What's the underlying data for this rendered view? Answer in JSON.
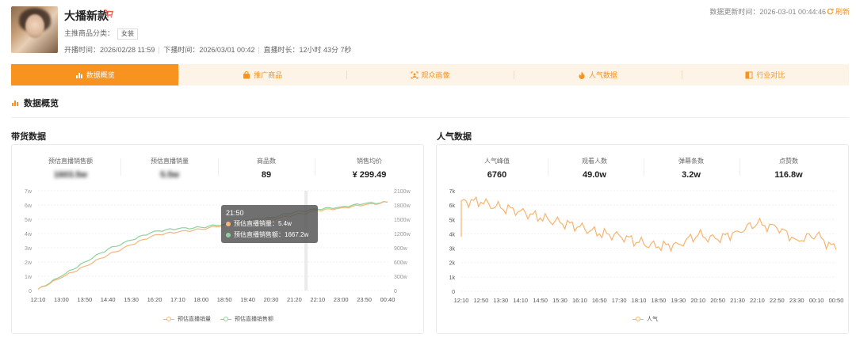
{
  "header": {
    "title": "大播新款",
    "category_label": "主推商品分类：",
    "category_tag": "女装",
    "start_time": "开播时间：2026/02/28 11:59",
    "end_time": "下播时间：2026/03/01 00:42",
    "duration": "直播时长：12小时 43分 7秒",
    "update_time": "数据更新时间：2026-03-01 00:44:46",
    "refresh_label": "刷新"
  },
  "tabs": [
    {
      "label": "数据概览",
      "icon": "bar-chart-icon",
      "active": true
    },
    {
      "label": "推广商品",
      "icon": "shopping-bag-icon",
      "active": false
    },
    {
      "label": "观众画像",
      "icon": "audience-icon",
      "active": false
    },
    {
      "label": "人气数据",
      "icon": "flame-icon",
      "active": false
    },
    {
      "label": "行业对比",
      "icon": "compare-icon",
      "active": false
    }
  ],
  "section_title": "数据概览",
  "sales": {
    "title": "带货数据",
    "kpis": [
      {
        "label": "预估直播销售额",
        "value": "1603.5w",
        "blurred": true
      },
      {
        "label": "预估直播销量",
        "value": "5.5w",
        "blurred": true
      },
      {
        "label": "商品数",
        "value": "89",
        "blurred": false
      },
      {
        "label": "销售均价",
        "value": "¥ 299.49",
        "blurred": false
      }
    ]
  },
  "popularity": {
    "title": "人气数据",
    "kpis": [
      {
        "label": "人气峰值",
        "value": "6760"
      },
      {
        "label": "观看人数",
        "value": "49.0w"
      },
      {
        "label": "弹幕条数",
        "value": "3.2w"
      },
      {
        "label": "点赞数",
        "value": "116.8w"
      }
    ]
  },
  "tooltip": {
    "time": "21:50",
    "rows": [
      {
        "text": "预估直播销量：5.4w",
        "color": "#f5b67b"
      },
      {
        "text": "预估直播销售额：1667.2w",
        "color": "#8fd19e"
      }
    ]
  },
  "colors": {
    "accent": "#f7931e",
    "volume": "#f5b67b",
    "revenue": "#8fd19e",
    "popularity": "#f6b46e"
  },
  "chart_data": [
    {
      "type": "line",
      "title": "",
      "x": [
        "12:10",
        "13:00",
        "13:50",
        "14:40",
        "15:30",
        "16:20",
        "17:10",
        "18:00",
        "18:50",
        "19:40",
        "20:30",
        "21:20",
        "22:10",
        "23:00",
        "23:50",
        "00:40"
      ],
      "y_left_ticks": [
        "0",
        "1w",
        "2w",
        "3w",
        "4w",
        "5w",
        "6w",
        "7w"
      ],
      "y_right_ticks": [
        "0",
        "300w",
        "600w",
        "900w",
        "1200w",
        "1500w",
        "1800w",
        "2100w"
      ],
      "ylim_left": [
        0,
        7
      ],
      "ylim_right": [
        0,
        2100
      ],
      "series": [
        {
          "name": "预估直播销量",
          "axis": "left",
          "color": "#f5b67b",
          "values": [
            0.1,
            0.9,
            1.7,
            2.5,
            3.2,
            3.9,
            4.1,
            4.3,
            4.6,
            4.8,
            5.0,
            5.3,
            5.6,
            5.8,
            6.0,
            6.2
          ]
        },
        {
          "name": "预估直播销售额",
          "axis": "right",
          "color": "#8fd19e",
          "values": [
            30,
            300,
            600,
            870,
            1060,
            1250,
            1300,
            1330,
            1400,
            1480,
            1540,
            1650,
            1710,
            1760,
            1830,
            1860
          ]
        }
      ],
      "legend": [
        "预估直播销量",
        "预估直播销售额"
      ],
      "legend_position": "bottom"
    },
    {
      "type": "line",
      "title": "",
      "x": [
        "12:10",
        "12:50",
        "13:30",
        "14:10",
        "14:50",
        "15:30",
        "16:10",
        "16:50",
        "17:30",
        "18:10",
        "18:50",
        "19:30",
        "20:10",
        "20:50",
        "21:30",
        "22:10",
        "22:50",
        "23:30",
        "00:10",
        "00:50"
      ],
      "y_ticks": [
        "0",
        "1k",
        "2k",
        "3k",
        "4k",
        "5k",
        "6k",
        "7k"
      ],
      "ylim": [
        0,
        7000
      ],
      "series": [
        {
          "name": "人气",
          "color": "#f6b46e",
          "values": [
            6300,
            6200,
            5800,
            5600,
            5100,
            4800,
            4500,
            4000,
            3900,
            3400,
            3100,
            3300,
            3900,
            3600,
            4200,
            4700,
            4400,
            3600,
            3900,
            2900
          ]
        }
      ],
      "legend": [
        "人气"
      ],
      "legend_position": "bottom"
    }
  ]
}
